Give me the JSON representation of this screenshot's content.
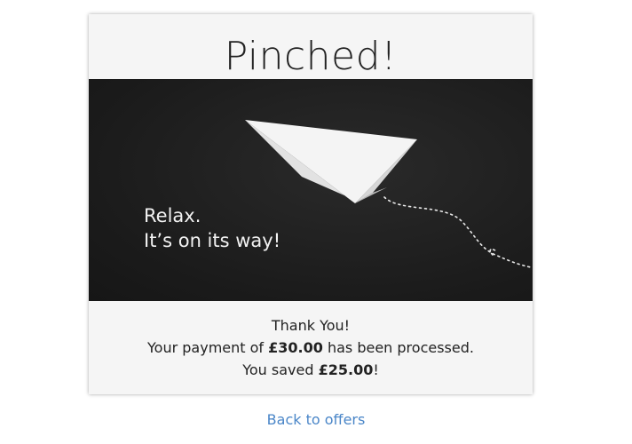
{
  "card": {
    "title": "Pinched!"
  },
  "banner": {
    "line1": "Relax.",
    "line2": "It’s on its way!",
    "illustration": "paper-plane-icon"
  },
  "message": {
    "thank_you": "Thank You!",
    "payment_prefix": "Your payment of ",
    "payment_amount": "£30.00",
    "payment_suffix": " has been processed.",
    "saved_prefix": "You saved ",
    "saved_amount": "£25.00",
    "saved_suffix": "!"
  },
  "footer": {
    "back_link": "Back to offers"
  },
  "colors": {
    "link": "#4a86c8",
    "banner_background": "#1b1b1b",
    "card_background": "#f5f5f5"
  }
}
